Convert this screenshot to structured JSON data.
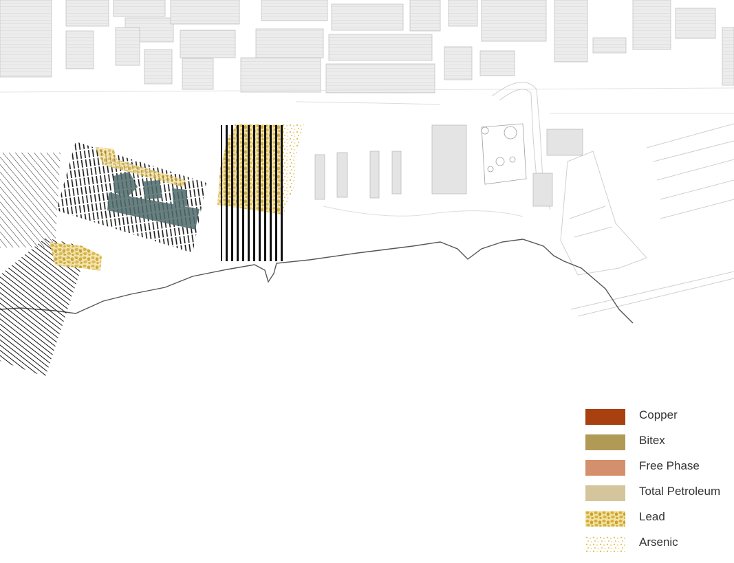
{
  "colors": {
    "building_fill": "#ececec",
    "building_stroke": "#bdbdbd",
    "outline_light": "#c8c8c8",
    "shoreline": "#555555",
    "hatch": "#111111",
    "teal_zone": "#4f6b6c",
    "lead": "#d4af37",
    "lead_light": "#e6c766"
  },
  "legend": {
    "items": [
      {
        "label": "Copper",
        "color": "#a8400f",
        "pattern": "solid"
      },
      {
        "label": "Bitex",
        "color": "#b09a55",
        "pattern": "solid"
      },
      {
        "label": "Free Phase",
        "color": "#d4906c",
        "pattern": "solid"
      },
      {
        "label": "Total Petroleum",
        "color": "#d4c59c",
        "pattern": "solid"
      },
      {
        "label": "Lead",
        "color": "#d4af37",
        "pattern": "lead-dots"
      },
      {
        "label": "Arsenic",
        "color": "#d4af37",
        "pattern": "arsenic-dots"
      }
    ]
  }
}
